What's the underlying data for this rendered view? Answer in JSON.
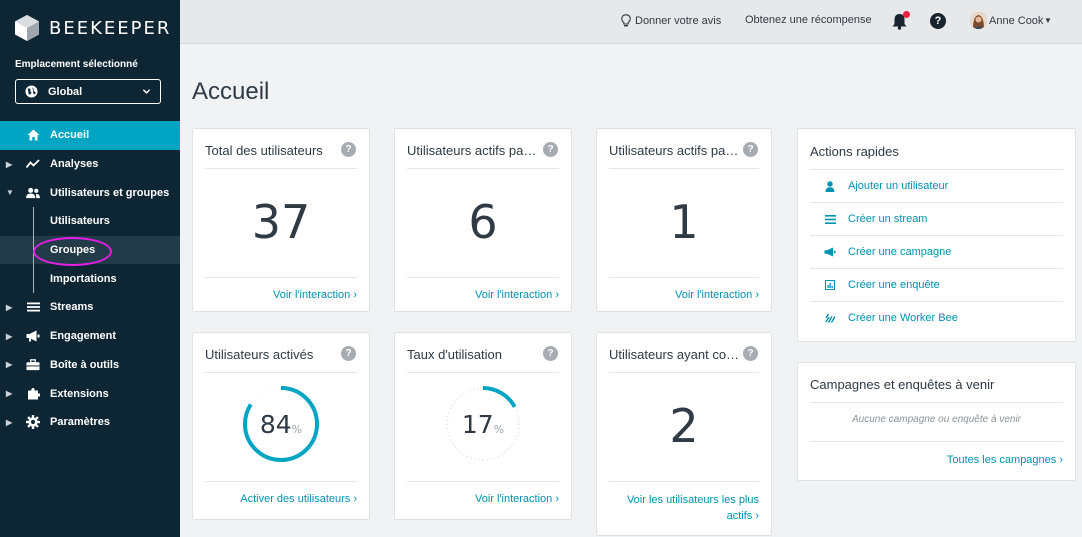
{
  "brand": {
    "name": "BEEKEEPER"
  },
  "location": {
    "label": "Emplacement sélectionné",
    "value": "Global"
  },
  "nav": {
    "home": "Accueil",
    "analytics": "Analyses",
    "users_groups": "Utilisateurs et groupes",
    "users": "Utilisateurs",
    "groups": "Groupes",
    "imports": "Importations",
    "streams": "Streams",
    "engagement": "Engagement",
    "toolbox": "Boîte à outils",
    "extensions": "Extensions",
    "settings": "Paramètres"
  },
  "topbar": {
    "feedback": "Donner votre avis",
    "reward": "Obtenez une récompense",
    "help": "?",
    "user": "Anne Cook"
  },
  "page": {
    "title": "Accueil"
  },
  "cards": {
    "total_users": {
      "title": "Total des utilisateurs",
      "value": "37",
      "link": "Voir l'interaction ›"
    },
    "active_users_1": {
      "title": "Utilisateurs actifs pa…",
      "value": "6",
      "link": "Voir l'interaction ›"
    },
    "active_users_2": {
      "title": "Utilisateurs actifs pa…",
      "value": "1",
      "link": "Voir l'interaction ›"
    },
    "activated_users": {
      "title": "Utilisateurs activés",
      "value": "84",
      "unit": "%",
      "fraction": 0.84,
      "link": "Activer des utilisateurs ›"
    },
    "usage_rate": {
      "title": "Taux d'utilisation",
      "value": "17",
      "unit": "%",
      "fraction": 0.17,
      "link": "Voir l'interaction ›"
    },
    "users_with": {
      "title": "Utilisateurs ayant co…",
      "value": "2",
      "link": "Voir les utilisateurs les plus actifs ›"
    }
  },
  "quick_actions": {
    "title": "Actions rapides",
    "items": [
      {
        "label": "Ajouter un utilisateur",
        "icon": "user-icon"
      },
      {
        "label": "Créer un stream",
        "icon": "list-icon"
      },
      {
        "label": "Créer une campagne",
        "icon": "megaphone-icon"
      },
      {
        "label": "Créer une enquête",
        "icon": "survey-icon"
      },
      {
        "label": "Créer une Worker Bee",
        "icon": "worker-bee-icon"
      }
    ]
  },
  "campaigns": {
    "title": "Campagnes et enquêtes à venir",
    "empty": "Aucune campagne ou enquête à venir",
    "link": "Toutes les campagnes ›"
  },
  "colors": {
    "sidebar": "#0e2634",
    "accent": "#00a5c3",
    "link": "#0092b3",
    "highlight": "#e51ee8",
    "notification": "#e8203f"
  }
}
